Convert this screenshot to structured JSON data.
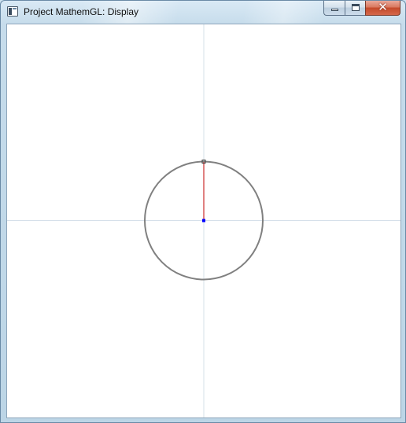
{
  "window": {
    "title": "Project MathemGL: Display",
    "app_icon": "window-app-icon",
    "buttons": {
      "minimize_icon": "minimize-icon",
      "maximize_icon": "maximize-icon",
      "close_icon": "close-icon",
      "close_glyph": "✕"
    }
  },
  "display": {
    "background_color": "#ffffff",
    "axis_color": "#d6e0ea",
    "circle_color": "#808080",
    "radius_line_color": "#c00000",
    "center_point_color": "#0000ff",
    "endpoint_color": "#404040"
  }
}
